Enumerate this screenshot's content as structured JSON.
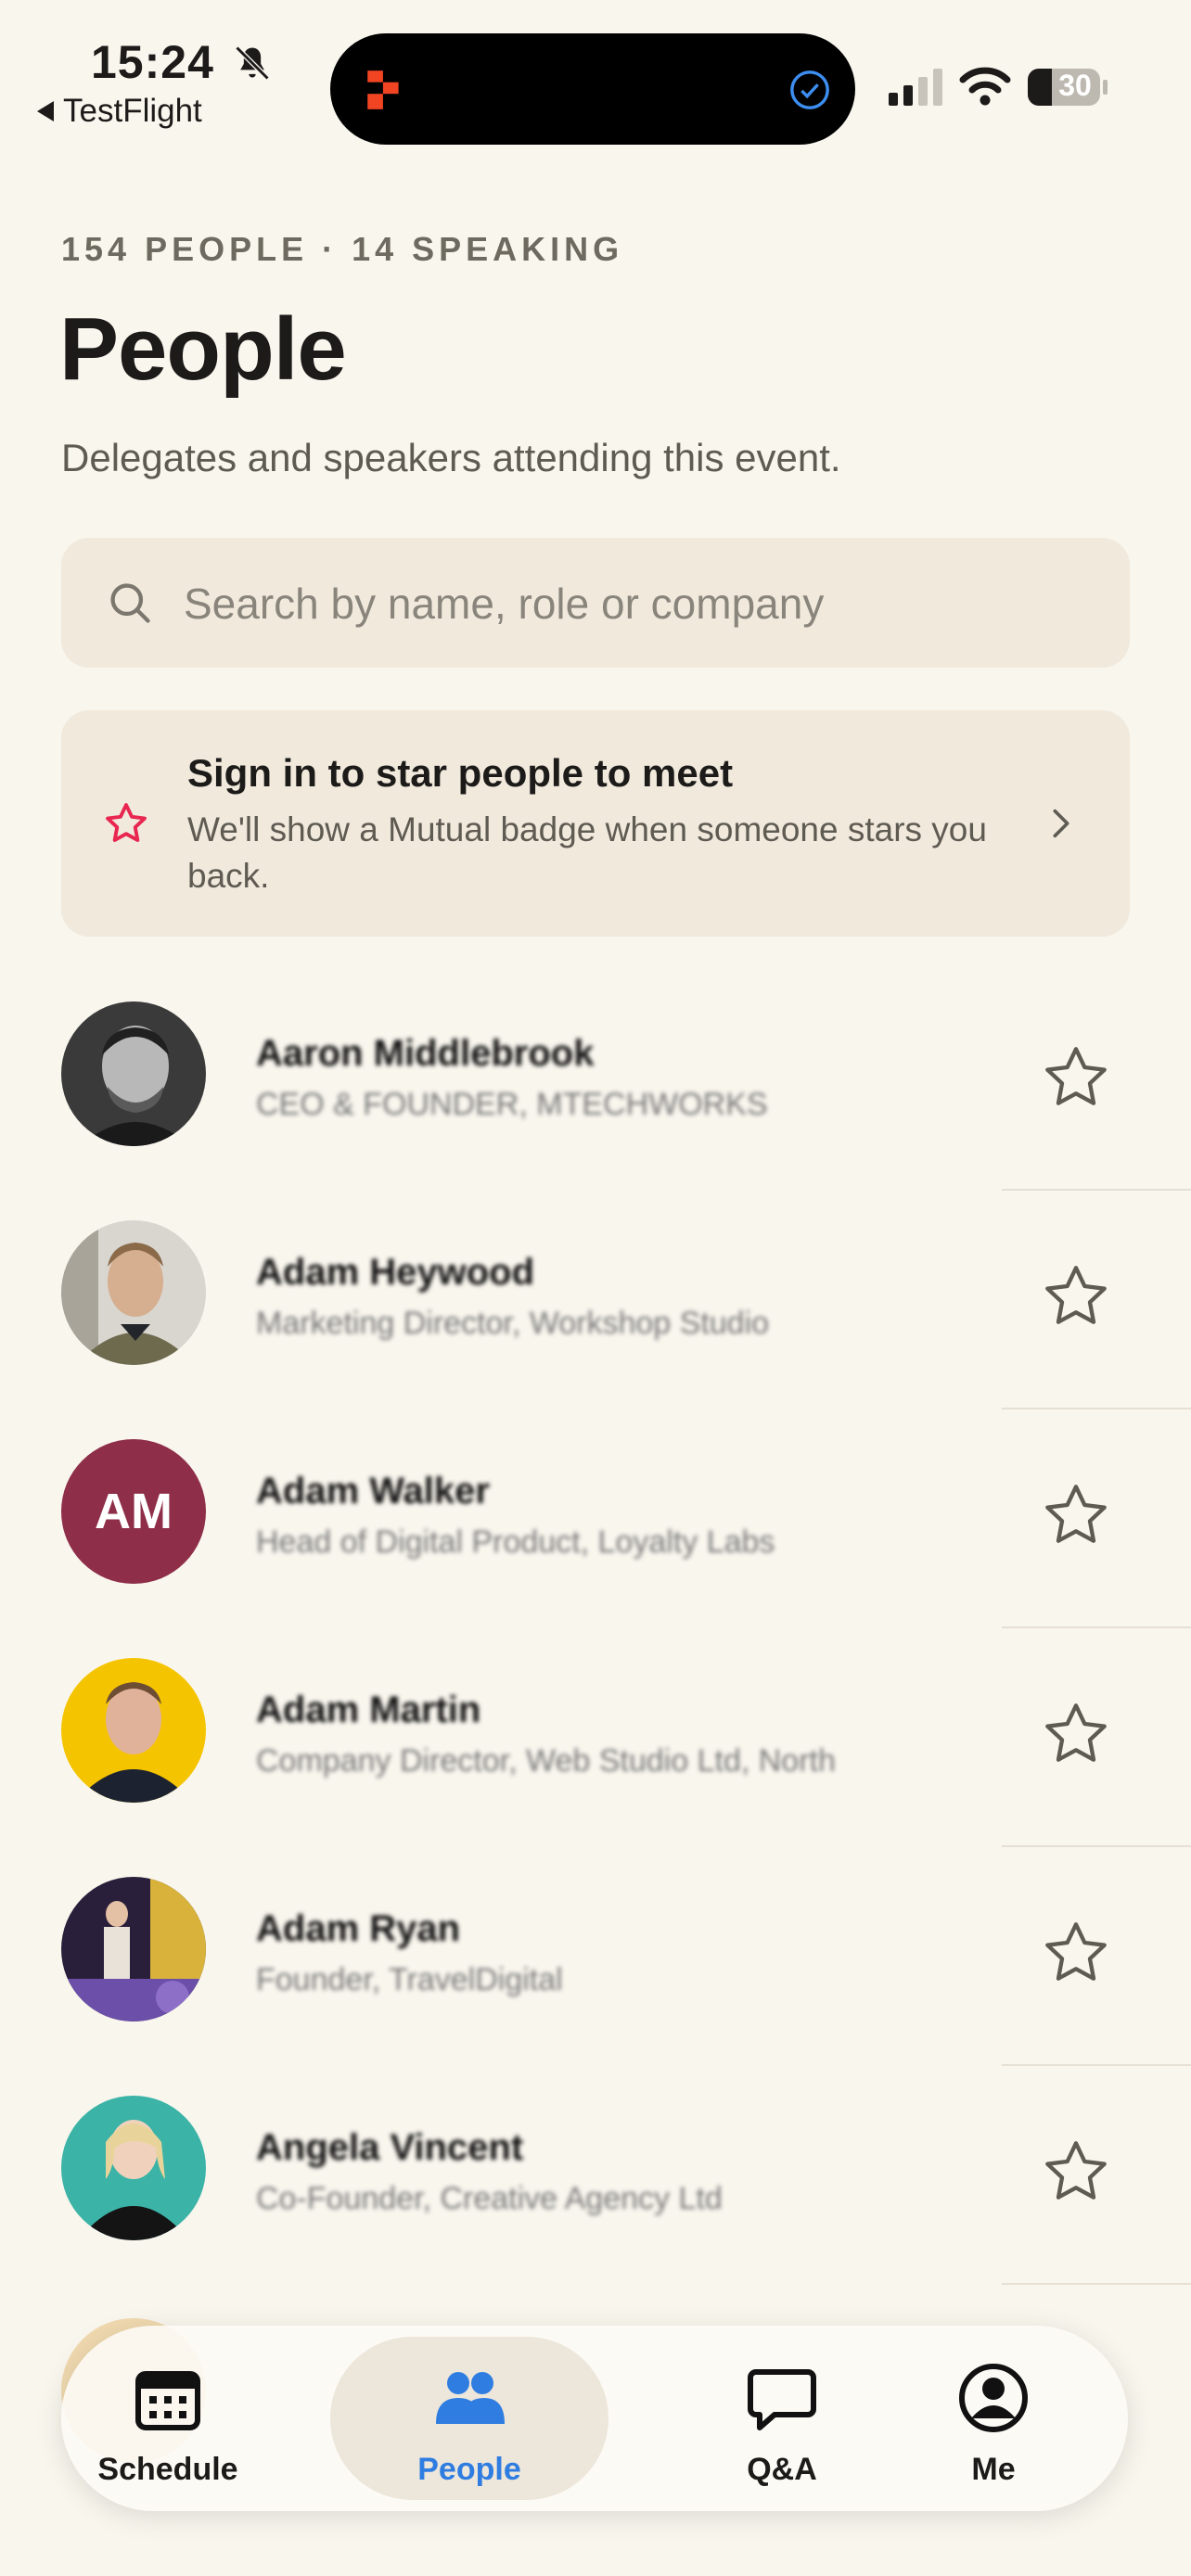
{
  "status_bar": {
    "time": "15:24",
    "back_app": "TestFlight",
    "battery": "30"
  },
  "header": {
    "eyebrow": "154 PEOPLE · 14 SPEAKING",
    "title": "People",
    "subtitle": "Delegates and speakers attending this event."
  },
  "search": {
    "placeholder": "Search by name, role or company",
    "value": ""
  },
  "signin_card": {
    "title": "Sign in to star people to meet",
    "body": "We'll show a Mutual badge when someone stars you back."
  },
  "people": [
    {
      "name": "Aaron Middlebrook",
      "role": "CEO & FOUNDER, MTECHWORKS",
      "avatar": "photo-grayscale-man"
    },
    {
      "name": "Adam Heywood",
      "role": "Marketing Director, Workshop Studio",
      "avatar": "photo-man-jacket"
    },
    {
      "name": "Adam Walker",
      "role": "Head of Digital Product, Loyalty Labs",
      "avatar_initials": "AM"
    },
    {
      "name": "Adam Martin",
      "role": "Company Director, Web Studio Ltd, North",
      "avatar": "photo-man-yellow-bg"
    },
    {
      "name": "Adam Ryan",
      "role": "Founder, TravelDigital",
      "avatar": "photo-speaker-stage"
    },
    {
      "name": "Angela Vincent",
      "role": "Co-Founder, Creative Agency Ltd",
      "avatar": "photo-woman-teal-bg"
    }
  ],
  "tabs": [
    {
      "label": "Schedule",
      "icon": "calendar-icon"
    },
    {
      "label": "People",
      "icon": "people-icon",
      "active": true
    },
    {
      "label": "Q&A",
      "icon": "chat-bubble-icon"
    },
    {
      "label": "Me",
      "icon": "profile-icon"
    }
  ],
  "colors": {
    "background": "#f9f6ee",
    "card": "#f0e9dc",
    "accent_blue": "#2f7de1",
    "star_pink": "#e8264f",
    "initials_avatar": "#8e2e48"
  }
}
